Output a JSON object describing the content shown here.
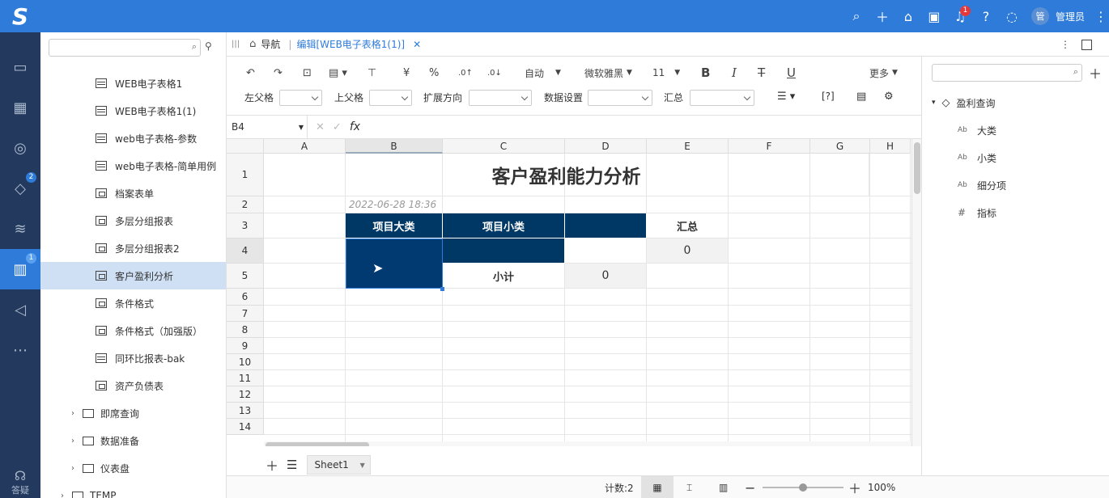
{
  "topbar": {
    "user_avatar": "管",
    "user_name": "管理员",
    "notif_count": "1"
  },
  "rail": {
    "badge_cube": "2",
    "badge_report": "1",
    "bottom_label": "答疑"
  },
  "tree": {
    "items": [
      {
        "label": "WEB电子表格1",
        "icon": "table"
      },
      {
        "label": "WEB电子表格1(1)",
        "icon": "table"
      },
      {
        "label": "web电子表格-参数",
        "icon": "table"
      },
      {
        "label": "web电子表格-简单用例",
        "icon": "table"
      },
      {
        "label": "档案表单",
        "icon": "image"
      },
      {
        "label": "多层分组报表",
        "icon": "image"
      },
      {
        "label": "多层分组报表2",
        "icon": "image"
      },
      {
        "label": "客户盈利分析",
        "icon": "image"
      },
      {
        "label": "条件格式",
        "icon": "image"
      },
      {
        "label": "条件格式（加强版）",
        "icon": "image"
      },
      {
        "label": "同环比报表-bak",
        "icon": "table"
      },
      {
        "label": "资产负债表",
        "icon": "image"
      }
    ],
    "folders": [
      {
        "label": "即席查询"
      },
      {
        "label": "数据准备"
      },
      {
        "label": "仪表盘"
      },
      {
        "label": "TEMP"
      }
    ]
  },
  "tabs": {
    "nav": "导航",
    "edit": "编辑[WEB电子表格1(1)]"
  },
  "toolbar": {
    "currency": "¥",
    "percent": "%",
    "auto": "自动",
    "font": "微软雅黑",
    "size": "11",
    "bold": "B",
    "italic": "I",
    "strike": "T",
    "underline": "U",
    "more": "更多",
    "left_parent": "左父格",
    "top_parent": "上父格",
    "expand_dir": "扩展方向",
    "data_settings": "数据设置",
    "summary": "汇总",
    "help": "[?]"
  },
  "formula": {
    "cell_ref": "B4",
    "fx": "fx"
  },
  "sheet": {
    "columns": [
      "A",
      "B",
      "C",
      "D",
      "E",
      "F",
      "G",
      "H"
    ],
    "rows": [
      "1",
      "2",
      "3",
      "4",
      "5",
      "6",
      "7",
      "8",
      "9",
      "10",
      "11",
      "12",
      "13",
      "14"
    ],
    "title": "客户盈利能力分析",
    "timestamp": "2022-06-28 18:36",
    "hdr_major": "项目大类",
    "hdr_minor": "项目小类",
    "hdr_total": "汇总",
    "total_value": "0",
    "subtotal_label": "小计",
    "subtotal_value": "0"
  },
  "sheettabs": {
    "sheet1": "Sheet1"
  },
  "status": {
    "count": "计数:2",
    "zoom": "100%"
  },
  "rpanel": {
    "root": "盈利查询",
    "fields": [
      {
        "prefix": "Ab",
        "label": "大类"
      },
      {
        "prefix": "Ab",
        "label": "小类"
      },
      {
        "prefix": "Ab",
        "label": "细分项"
      },
      {
        "prefix": "#",
        "label": "指标"
      }
    ]
  }
}
